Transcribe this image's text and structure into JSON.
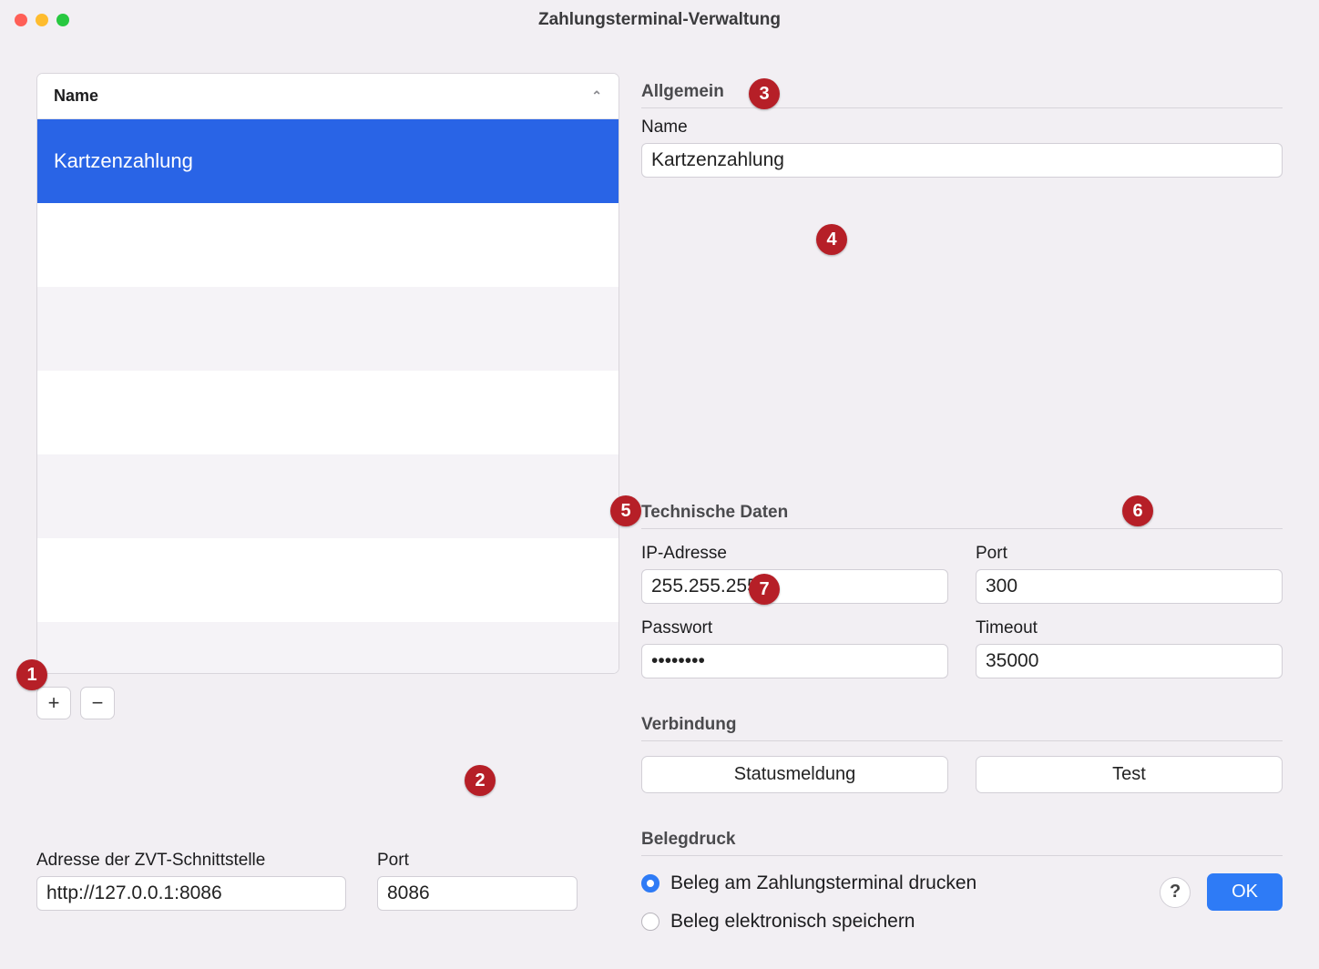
{
  "window": {
    "title": "Zahlungsterminal-Verwaltung"
  },
  "list": {
    "header": "Name",
    "items": [
      {
        "label": "Kartzenzahlung",
        "selected": true
      }
    ]
  },
  "buttons": {
    "add": "+",
    "remove": "−"
  },
  "zvt": {
    "address_label": "Adresse der ZVT-Schnittstelle",
    "address_value": "http://127.0.0.1:8086",
    "port_label": "Port",
    "port_value": "8086"
  },
  "sections": {
    "general": {
      "title": "Allgemein",
      "name_label": "Name",
      "name_value": "Kartzenzahlung"
    },
    "tech": {
      "title": "Technische Daten",
      "ip_label": "IP-Adresse",
      "ip_value": "255.255.255.0",
      "port_label": "Port",
      "port_value": "300",
      "password_label": "Passwort",
      "password_value": "••••••••",
      "timeout_label": "Timeout",
      "timeout_value": "35000"
    },
    "connection": {
      "title": "Verbindung",
      "status_btn": "Statusmeldung",
      "test_btn": "Test"
    },
    "receipt": {
      "title": "Belegdruck",
      "opt1": "Beleg am Zahlungsterminal drucken",
      "opt2": "Beleg elektronisch speichern"
    }
  },
  "footer": {
    "help": "?",
    "ok": "OK"
  },
  "callouts": {
    "c1": "1",
    "c2": "2",
    "c3": "3",
    "c4": "4",
    "c5": "5",
    "c6": "6",
    "c7": "7"
  }
}
